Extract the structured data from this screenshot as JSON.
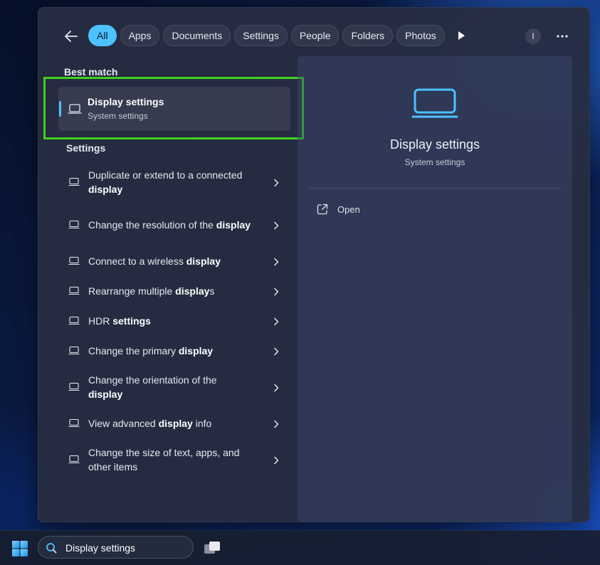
{
  "filters": [
    {
      "label": "All",
      "active": true
    },
    {
      "label": "Apps"
    },
    {
      "label": "Documents"
    },
    {
      "label": "Settings"
    },
    {
      "label": "People"
    },
    {
      "label": "Folders"
    },
    {
      "label": "Photos"
    }
  ],
  "user_initial": "I",
  "best_match": {
    "heading": "Best match",
    "title": "Display settings",
    "subtitle": "System settings"
  },
  "settings_section": {
    "heading": "Settings",
    "items": [
      {
        "parts": [
          [
            "Duplicate or extend to a connected ",
            false
          ],
          [
            "display",
            true
          ]
        ]
      },
      {
        "parts": [
          [
            "Change the resolution of the ",
            false
          ],
          [
            "display",
            true
          ]
        ]
      },
      {
        "parts": [
          [
            "Connect to a wireless ",
            false
          ],
          [
            "display",
            true
          ]
        ]
      },
      {
        "parts": [
          [
            "Rearrange multiple ",
            false
          ],
          [
            "display",
            true
          ],
          [
            "s",
            false
          ]
        ]
      },
      {
        "parts": [
          [
            "HDR ",
            false
          ],
          [
            "settings",
            true
          ]
        ]
      },
      {
        "parts": [
          [
            "Change the primary ",
            false
          ],
          [
            "display",
            true
          ]
        ]
      },
      {
        "parts": [
          [
            "Change the orientation of the ",
            false
          ],
          [
            "display",
            true
          ]
        ]
      },
      {
        "parts": [
          [
            "View advanced ",
            false
          ],
          [
            "display",
            true
          ],
          [
            " info",
            false
          ]
        ]
      },
      {
        "parts": [
          [
            "Change the size of text, apps, and other items",
            false
          ]
        ]
      }
    ]
  },
  "preview": {
    "title": "Display settings",
    "subtitle": "System settings",
    "actions": [
      {
        "label": "Open",
        "icon": "open-external-icon"
      }
    ]
  },
  "taskbar": {
    "search_value": "Display settings"
  },
  "colors": {
    "accent": "#4cc2ff",
    "highlight": "#3fd11e"
  }
}
